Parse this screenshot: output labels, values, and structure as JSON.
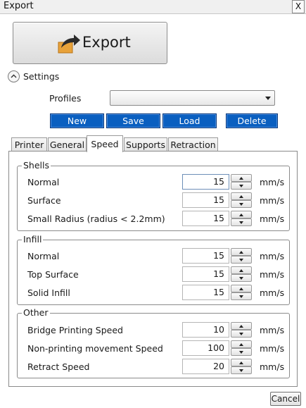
{
  "window": {
    "title": "Export",
    "close_label": "X"
  },
  "export_button": {
    "label": "Export",
    "icon": "export-arrow-icon"
  },
  "settings": {
    "label": "Settings",
    "toggle_icon": "chevron-up-circle-icon"
  },
  "profiles": {
    "label": "Profiles",
    "selected": ""
  },
  "profile_buttons": {
    "new": "New",
    "save": "Save",
    "load": "Load",
    "delete": "Delete",
    "color": "#0a5fc0"
  },
  "tabs": [
    {
      "label": "Printer",
      "active": false
    },
    {
      "label": "General",
      "active": false
    },
    {
      "label": "Speed",
      "active": true
    },
    {
      "label": "Supports",
      "active": false
    },
    {
      "label": "Retraction",
      "active": false
    }
  ],
  "groups": {
    "shells": {
      "title": "Shells",
      "rows": [
        {
          "label": "Normal",
          "value": "15",
          "unit": "mm/s"
        },
        {
          "label": "Surface",
          "value": "15",
          "unit": "mm/s"
        },
        {
          "label": "Small Radius (radius < 2.2mm)",
          "value": "15",
          "unit": "mm/s"
        }
      ]
    },
    "infill": {
      "title": "Infill",
      "rows": [
        {
          "label": "Normal",
          "value": "15",
          "unit": "mm/s"
        },
        {
          "label": "Top Surface",
          "value": "15",
          "unit": "mm/s"
        },
        {
          "label": "Solid Infill",
          "value": "15",
          "unit": "mm/s"
        }
      ]
    },
    "other": {
      "title": "Other",
      "rows": [
        {
          "label": "Bridge Printing Speed",
          "value": "10",
          "unit": "mm/s"
        },
        {
          "label": "Non-printing movement Speed",
          "value": "100",
          "unit": "mm/s"
        },
        {
          "label": "Retract Speed",
          "value": "20",
          "unit": "mm/s"
        }
      ]
    }
  },
  "cancel_label": "Cancel"
}
